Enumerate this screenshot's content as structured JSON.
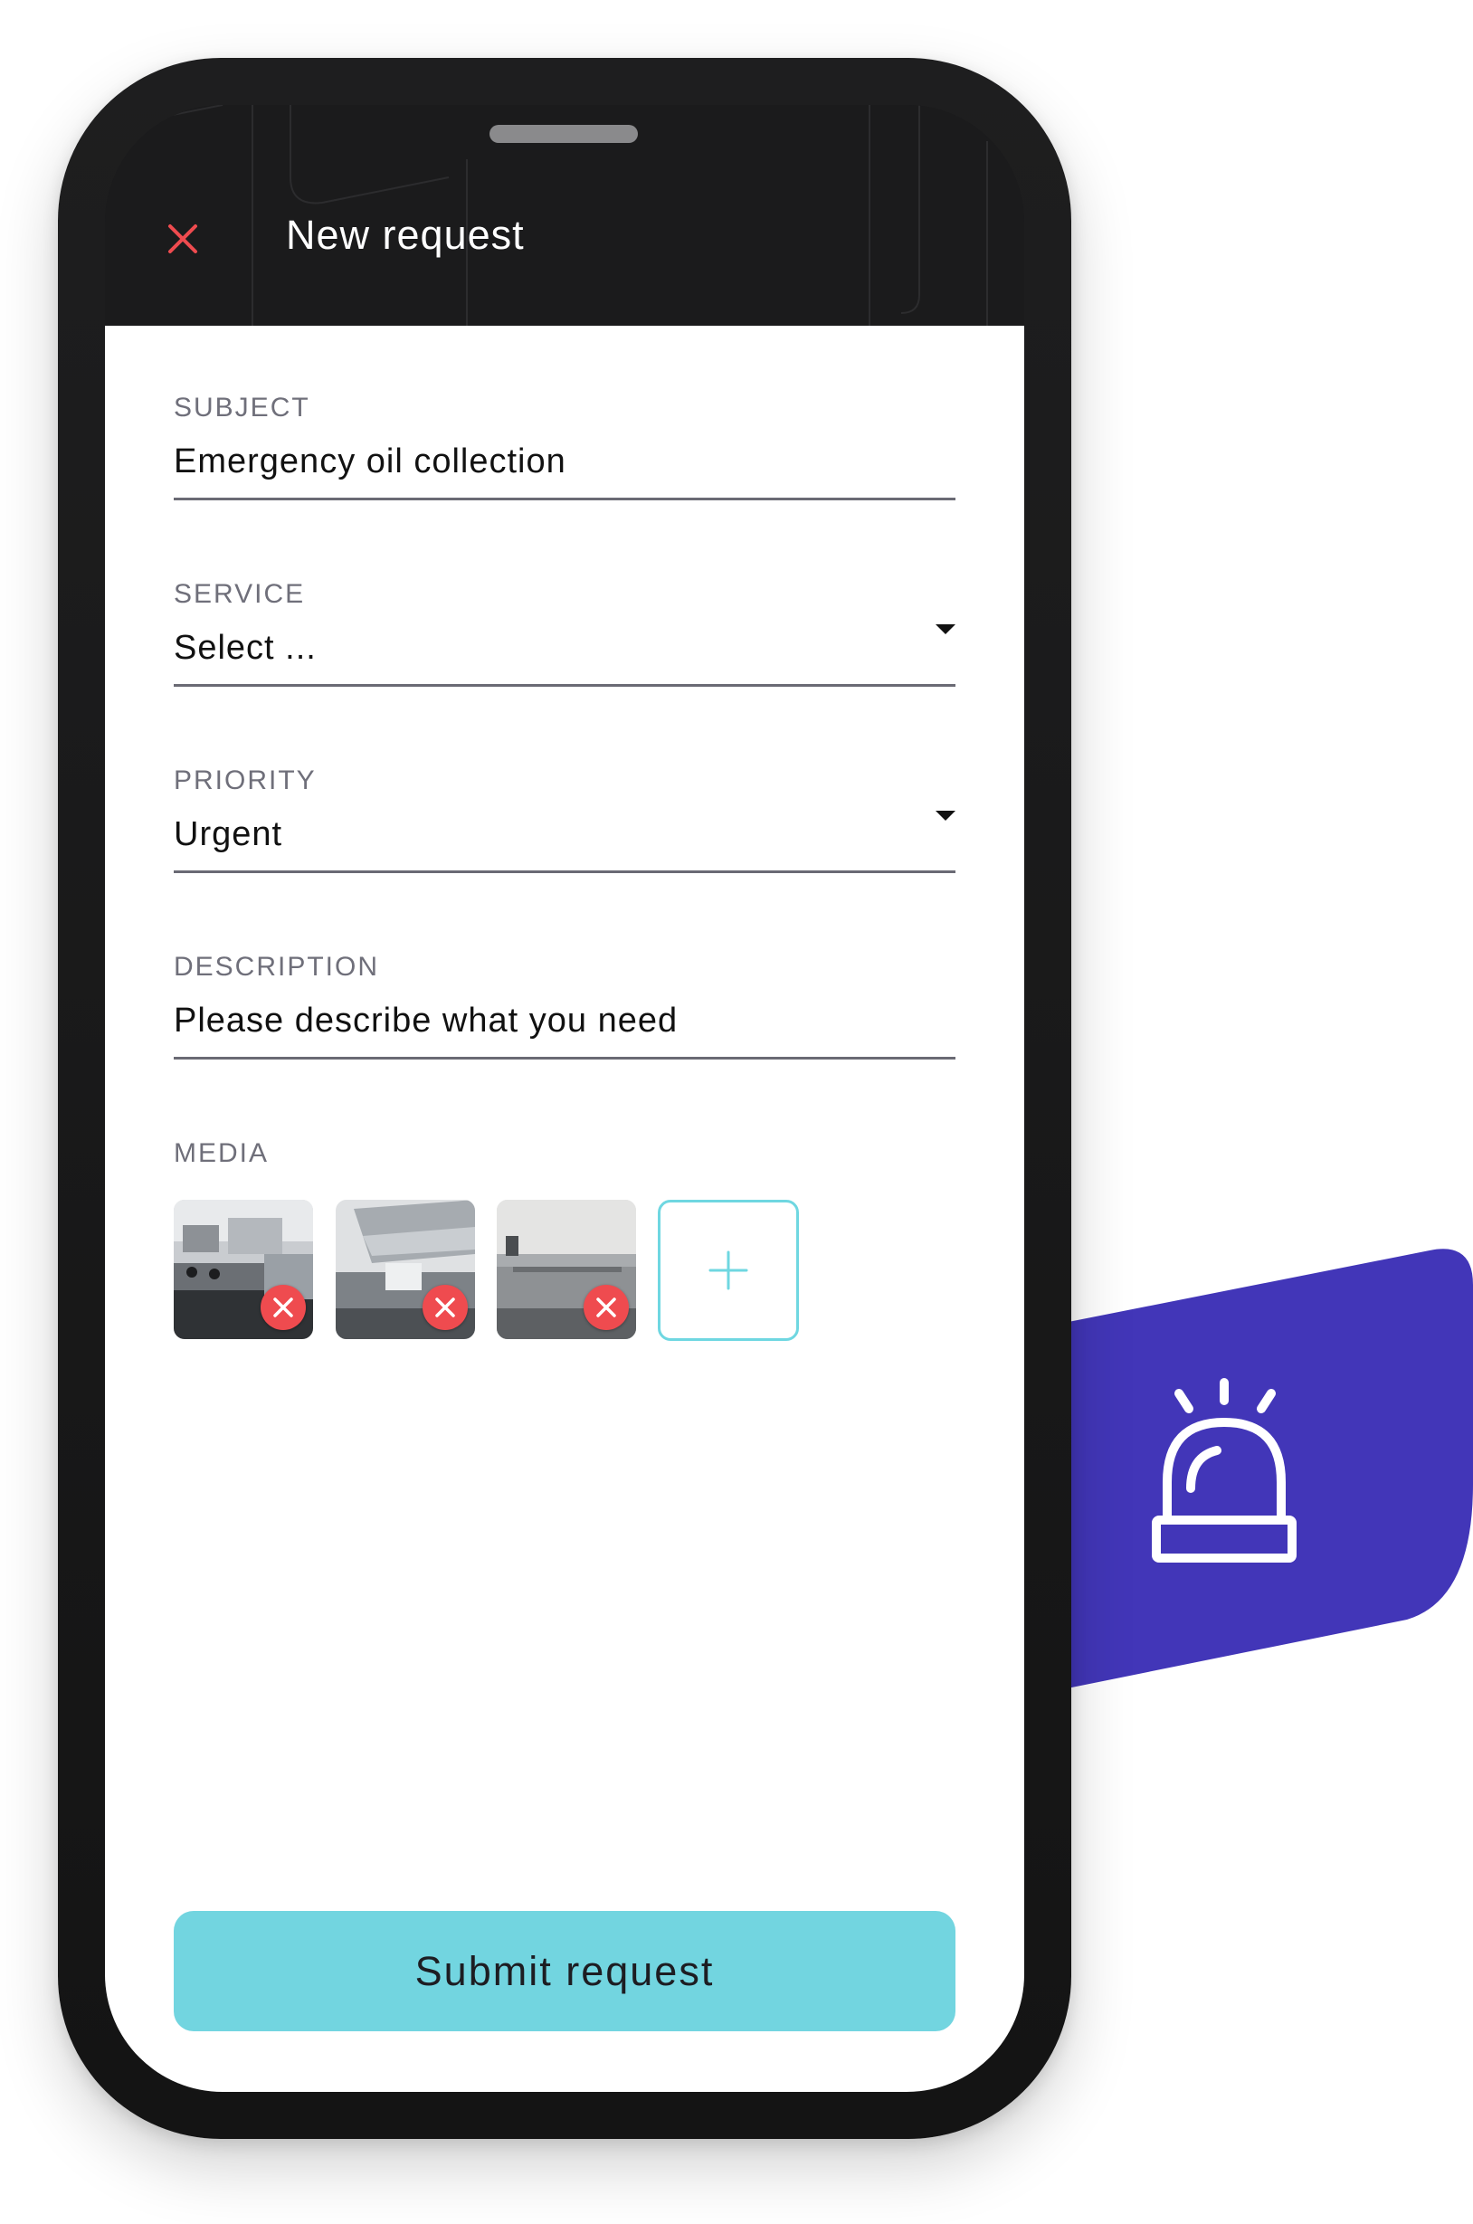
{
  "header": {
    "title": "New request",
    "close_icon": "close-x-icon",
    "accent_color": "#ef4b4f"
  },
  "form": {
    "subject": {
      "label": "SUBJECT",
      "value": "Emergency oil collection"
    },
    "service": {
      "label": "SERVICE",
      "value": "Select ..."
    },
    "priority": {
      "label": "PRIORITY",
      "value": "Urgent"
    },
    "description": {
      "label": "DESCRIPTION",
      "placeholder": "Please describe what you need"
    },
    "media": {
      "label": "MEDIA",
      "items": [
        {
          "name": "kitchen-photo-1",
          "remove_icon": "remove-x-icon"
        },
        {
          "name": "kitchen-photo-2",
          "remove_icon": "remove-x-icon"
        },
        {
          "name": "kitchen-photo-3",
          "remove_icon": "remove-x-icon"
        }
      ],
      "add_icon": "plus-icon"
    }
  },
  "submit": {
    "label": "Submit request",
    "color": "#72d5e0"
  },
  "badge": {
    "icon": "siren-alarm-icon",
    "color": "#4236b8"
  }
}
